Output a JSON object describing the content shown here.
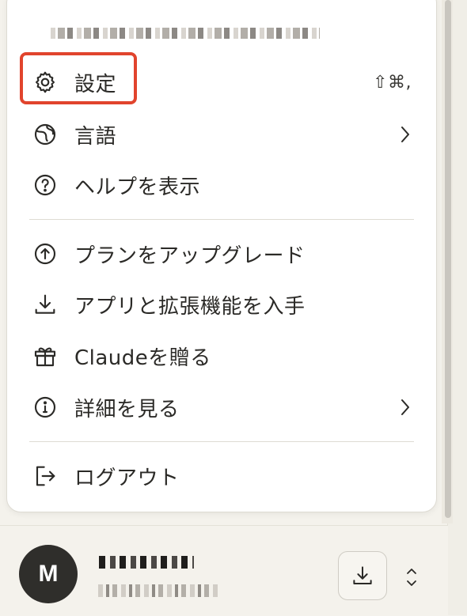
{
  "menu": {
    "items": [
      {
        "label": "設定",
        "shortcut": "⇧⌘,",
        "icon": "gear-icon"
      },
      {
        "label": "言語",
        "icon": "globe-icon",
        "has_submenu": true
      },
      {
        "label": "ヘルプを表示",
        "icon": "help-circle-icon"
      },
      {
        "label": "プランをアップグレード",
        "icon": "upgrade-arrow-icon"
      },
      {
        "label": "アプリと拡張機能を入手",
        "icon": "download-icon"
      },
      {
        "label": "Claudeを贈る",
        "icon": "gift-icon"
      },
      {
        "label": "詳細を見る",
        "icon": "info-icon",
        "has_submenu": true
      },
      {
        "label": "ログアウト",
        "icon": "logout-icon"
      }
    ],
    "highlight_color": "#e1442d"
  },
  "footer": {
    "avatar_initial": "M"
  },
  "colors": {
    "panel_bg": "#ffffff",
    "page_bg": "#f4f2ec",
    "text": "#2b2a27",
    "divider": "#dedbd3",
    "avatar_bg": "#2f2e2b"
  }
}
